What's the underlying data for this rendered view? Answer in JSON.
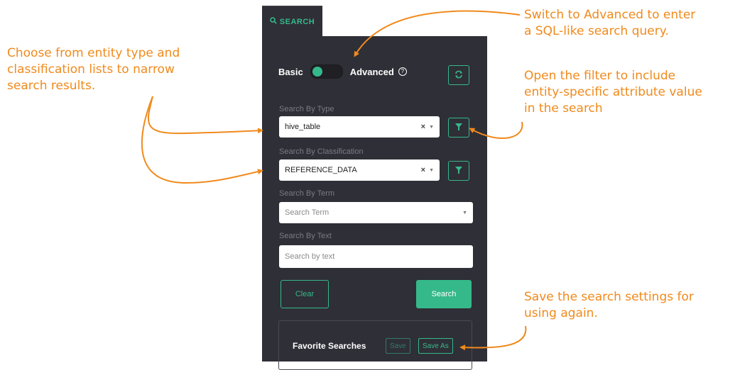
{
  "tab": {
    "icon": "search-icon",
    "label": "SEARCH"
  },
  "toggle": {
    "basic_label": "Basic",
    "advanced_label": "Advanced",
    "help_glyph": "?",
    "mode": "basic"
  },
  "refresh": {
    "icon": "refresh-icon",
    "glyph": "⟲"
  },
  "by_type": {
    "label": "Search By Type",
    "value": "hive_table",
    "clear_glyph": "×",
    "caret_glyph": "▼"
  },
  "by_classification": {
    "label": "Search By Classification",
    "value": "REFERENCE_DATA",
    "clear_glyph": "×",
    "caret_glyph": "▼"
  },
  "by_term": {
    "label": "Search By Term",
    "placeholder": "Search Term",
    "caret_glyph": "▼"
  },
  "by_text": {
    "label": "Search By Text",
    "placeholder": "Search by text"
  },
  "actions": {
    "clear_label": "Clear",
    "search_label": "Search"
  },
  "favorites": {
    "title": "Favorite Searches",
    "save_label": "Save",
    "save_as_label": "Save As"
  },
  "annotations": {
    "left_line1": "Choose from entity type and",
    "left_line2": "classification lists to narrow",
    "left_line3": "search results.",
    "adv_line1": "Switch to Advanced to enter",
    "adv_line2": "a SQL-like search query.",
    "filter_line1": "Open the filter to include",
    "filter_line2": "entity-specific attribute value",
    "filter_line3": "in the search",
    "save_line1": "Save the search settings for",
    "save_line2": "using again."
  },
  "colors": {
    "accent": "#35b98a",
    "panel": "#2f2f37",
    "annotation": "#f08a1c"
  }
}
